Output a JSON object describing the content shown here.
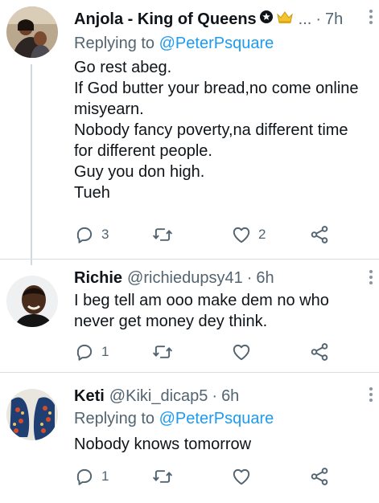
{
  "tweets": [
    {
      "name": "Anjola - King of Queens",
      "handle": "...",
      "time": "7h",
      "replying_to_prefix": "Replying to ",
      "replying_to_mention": "@PeterPsquare",
      "lines": [
        "Go rest abeg.",
        "If God butter your bread,no come online",
        "misyearn.",
        "Nobody fancy poverty,na different time",
        "for different people.",
        "Guy you don high.",
        "Tueh"
      ],
      "reply_count": "3",
      "retweet_count": "",
      "like_count": "2"
    },
    {
      "name": "Richie",
      "handle": "@richiedupsy41",
      "time": "6h",
      "lines": [
        "I beg tell am ooo make dem no who",
        "never get money dey think."
      ],
      "reply_count": "1",
      "retweet_count": "",
      "like_count": ""
    },
    {
      "name": "Keti",
      "handle": "@Kiki_dicap5",
      "time": "6h",
      "replying_to_prefix": "Replying to ",
      "replying_to_mention": "@PeterPsquare",
      "lines": [
        "Nobody knows tomorrow"
      ],
      "reply_count": "1",
      "retweet_count": "",
      "like_count": ""
    }
  ],
  "separator": "·",
  "colors": {
    "mention": "#1d9bf0",
    "secondary_text": "#536471",
    "primary_text": "#0f1419"
  },
  "icons": [
    "reply-icon",
    "retweet-icon",
    "like-icon",
    "share-icon",
    "more-icon"
  ]
}
